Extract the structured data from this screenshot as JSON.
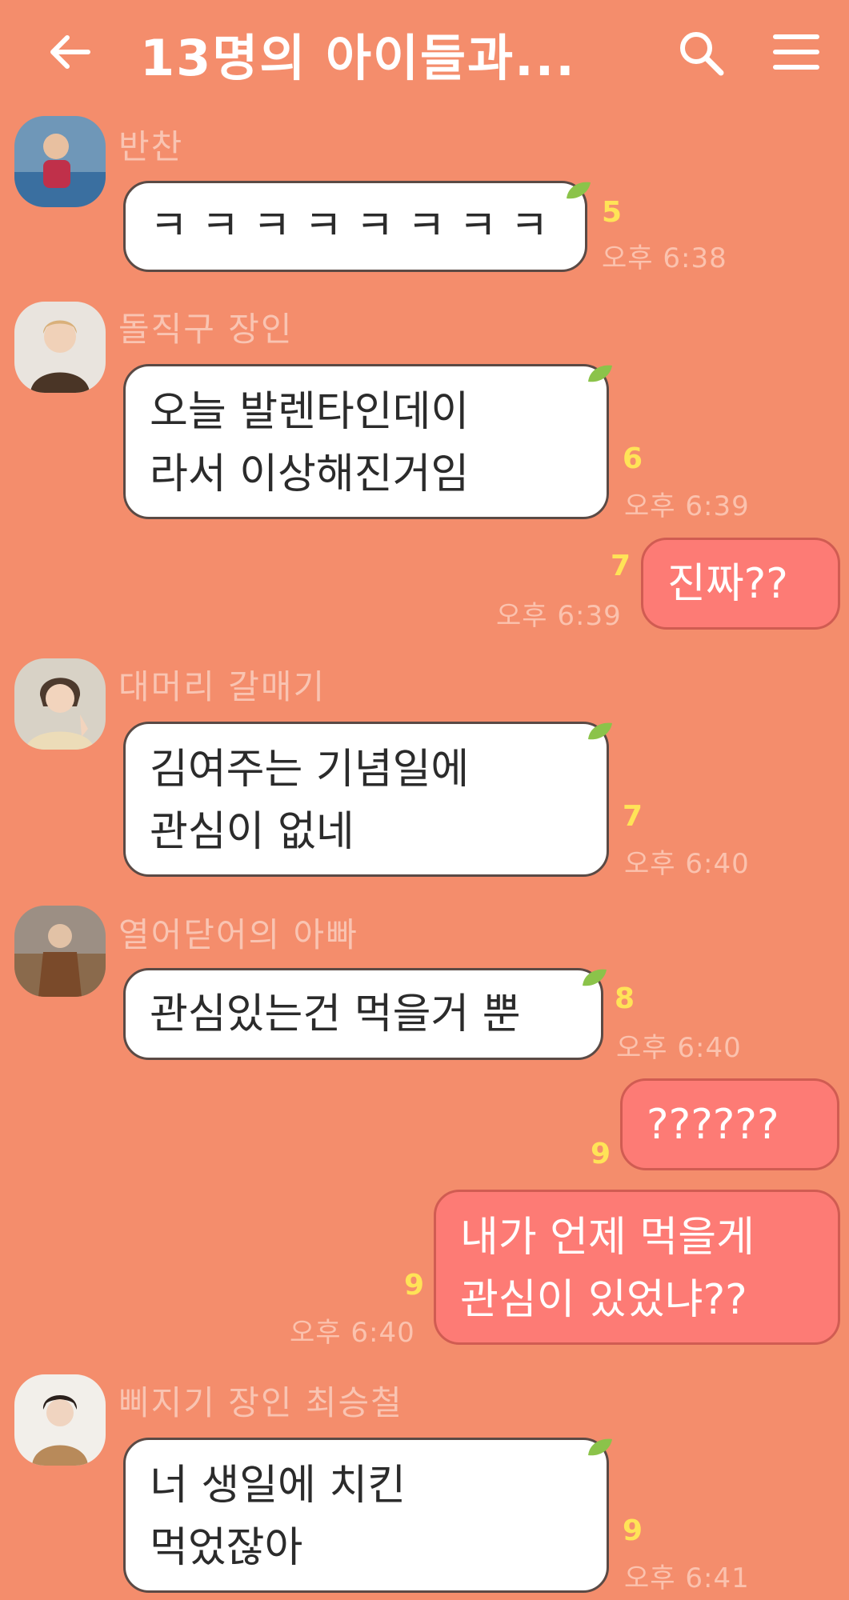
{
  "header": {
    "title": "13명의 아이들과...",
    "back_icon": "arrow-left-icon",
    "search_icon": "search-icon",
    "menu_icon": "hamburger-menu-icon"
  },
  "colors": {
    "background": "#f48d6c",
    "incoming_bubble": "#ffffff",
    "outgoing_bubble": "#fd7b75",
    "unread_count": "#ffe357",
    "leaf": "#8bc34a"
  },
  "messages": [
    {
      "sender": "반찬",
      "lines": [
        "ㅋ ㅋ ㅋ ㅋ ㅋ ㅋ ㅋ ㅋ"
      ],
      "unread": "5",
      "time": "오후 6:38"
    },
    {
      "sender": "돌직구 장인",
      "lines": [
        "오늘 발렌타인데이",
        "라서 이상해진거임"
      ],
      "unread": "6",
      "time": "오후 6:39"
    },
    {
      "sender": "",
      "lines": [
        "진짜??"
      ],
      "unread": "7",
      "time": "오후 6:39",
      "mine": true
    },
    {
      "sender": "대머리 갈매기",
      "lines": [
        "김여주는 기념일에",
        "관심이 없네"
      ],
      "unread": "7",
      "time": "오후 6:40"
    },
    {
      "sender": "열어닫어의 아빠",
      "lines": [
        "관심있는건 먹을거 뿐"
      ],
      "unread": "8",
      "time": "오후 6:40"
    },
    {
      "sender": "",
      "lines": [
        "??????"
      ],
      "unread": "9",
      "time": "",
      "mine": true
    },
    {
      "sender": "",
      "lines": [
        "내가 언제 먹을게",
        "관심이 있었냐??"
      ],
      "unread": "9",
      "time": "오후 6:40",
      "mine": true
    },
    {
      "sender": "삐지기 장인 최승철",
      "lines": [
        "너 생일에 치킨",
        "먹었잖아"
      ],
      "unread": "9",
      "time": "오후 6:41"
    }
  ]
}
